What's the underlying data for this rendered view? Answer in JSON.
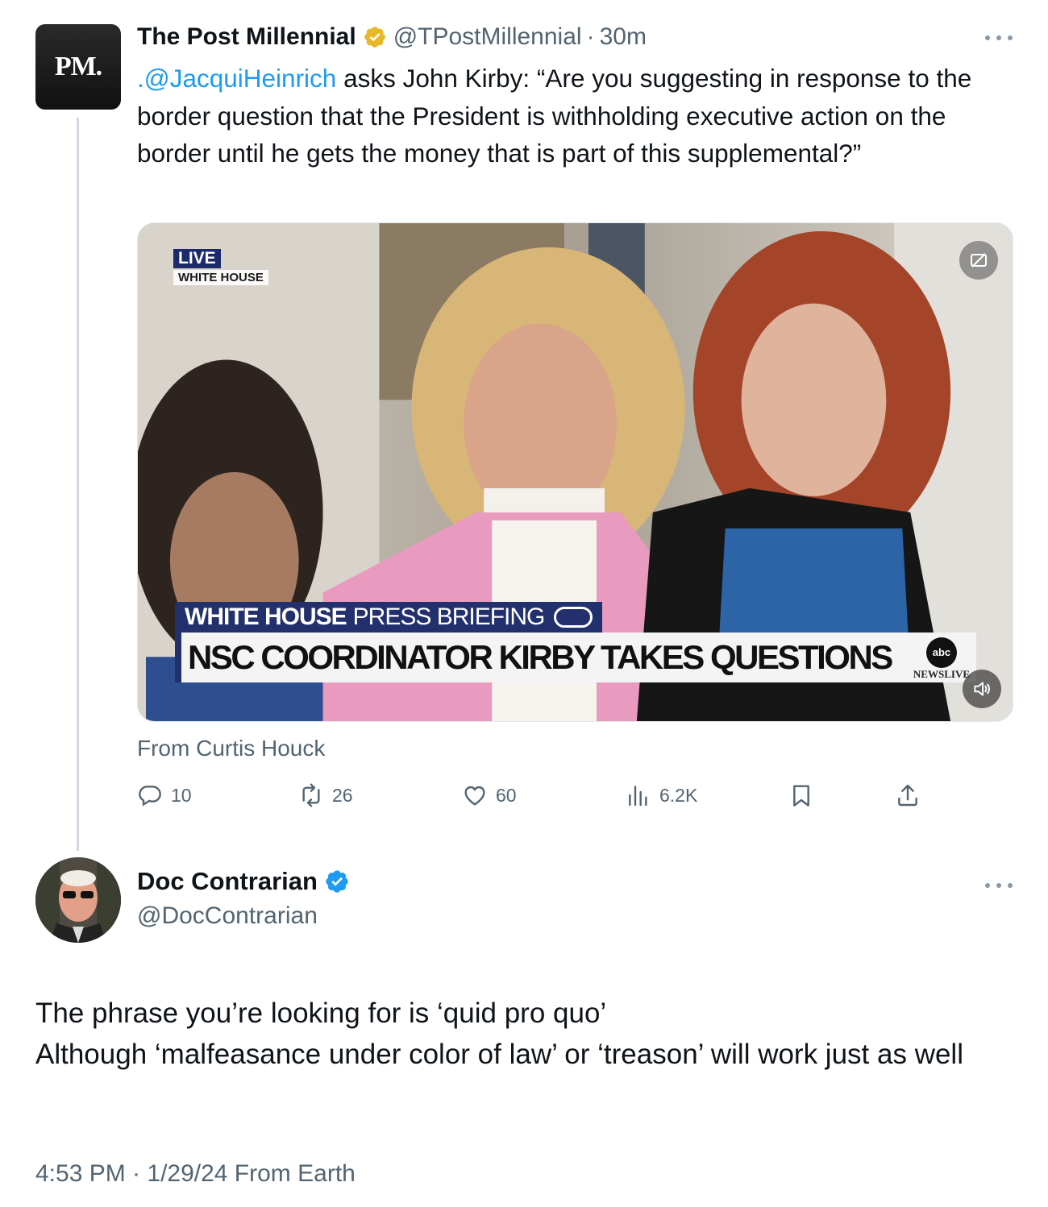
{
  "quoted_tweet": {
    "author_name": "The Post Millennial",
    "author_handle": "@TPostMillennial",
    "separator": "·",
    "time": "30m",
    "avatar_text": "PM.",
    "verified_color": "#e8b829",
    "mention": ".@JacquiHeinrich",
    "text": " asks John Kirby: “Are you suggesting in response to the border question that the President is withholding executive action on the border until he gets the money that is part of this supplemental?”",
    "media": {
      "live_tag": "LIVE",
      "live_location": "WHITE HOUSE",
      "banner_bold": "WHITE HOUSE",
      "banner_rest": "PRESS BRIEFING",
      "headline": "NSC COORDINATOR KIRBY TAKES QUESTIONS",
      "network_logo": "abc",
      "network_name": "NEWSLIVE"
    },
    "attribution": "From Curtis Houck",
    "actions": {
      "replies": "10",
      "reposts": "26",
      "likes": "60",
      "views": "6.2K"
    }
  },
  "reply_tweet": {
    "author_name": "Doc Contrarian",
    "author_handle": "@DocContrarian",
    "verified_color": "#1d9bf0",
    "text_line1": "The phrase you’re looking for is ‘quid pro quo’",
    "text_line2": "Although ‘malfeasance under color of law’ or ‘treason’ will work just as well",
    "meta": "4:53 PM · 1/29/24 From Earth"
  },
  "icons": [
    "verified-badge-icon",
    "more-icon",
    "reply-icon",
    "repost-icon",
    "like-icon",
    "views-icon",
    "bookmark-icon",
    "share-icon",
    "captions-icon",
    "volume-icon"
  ]
}
